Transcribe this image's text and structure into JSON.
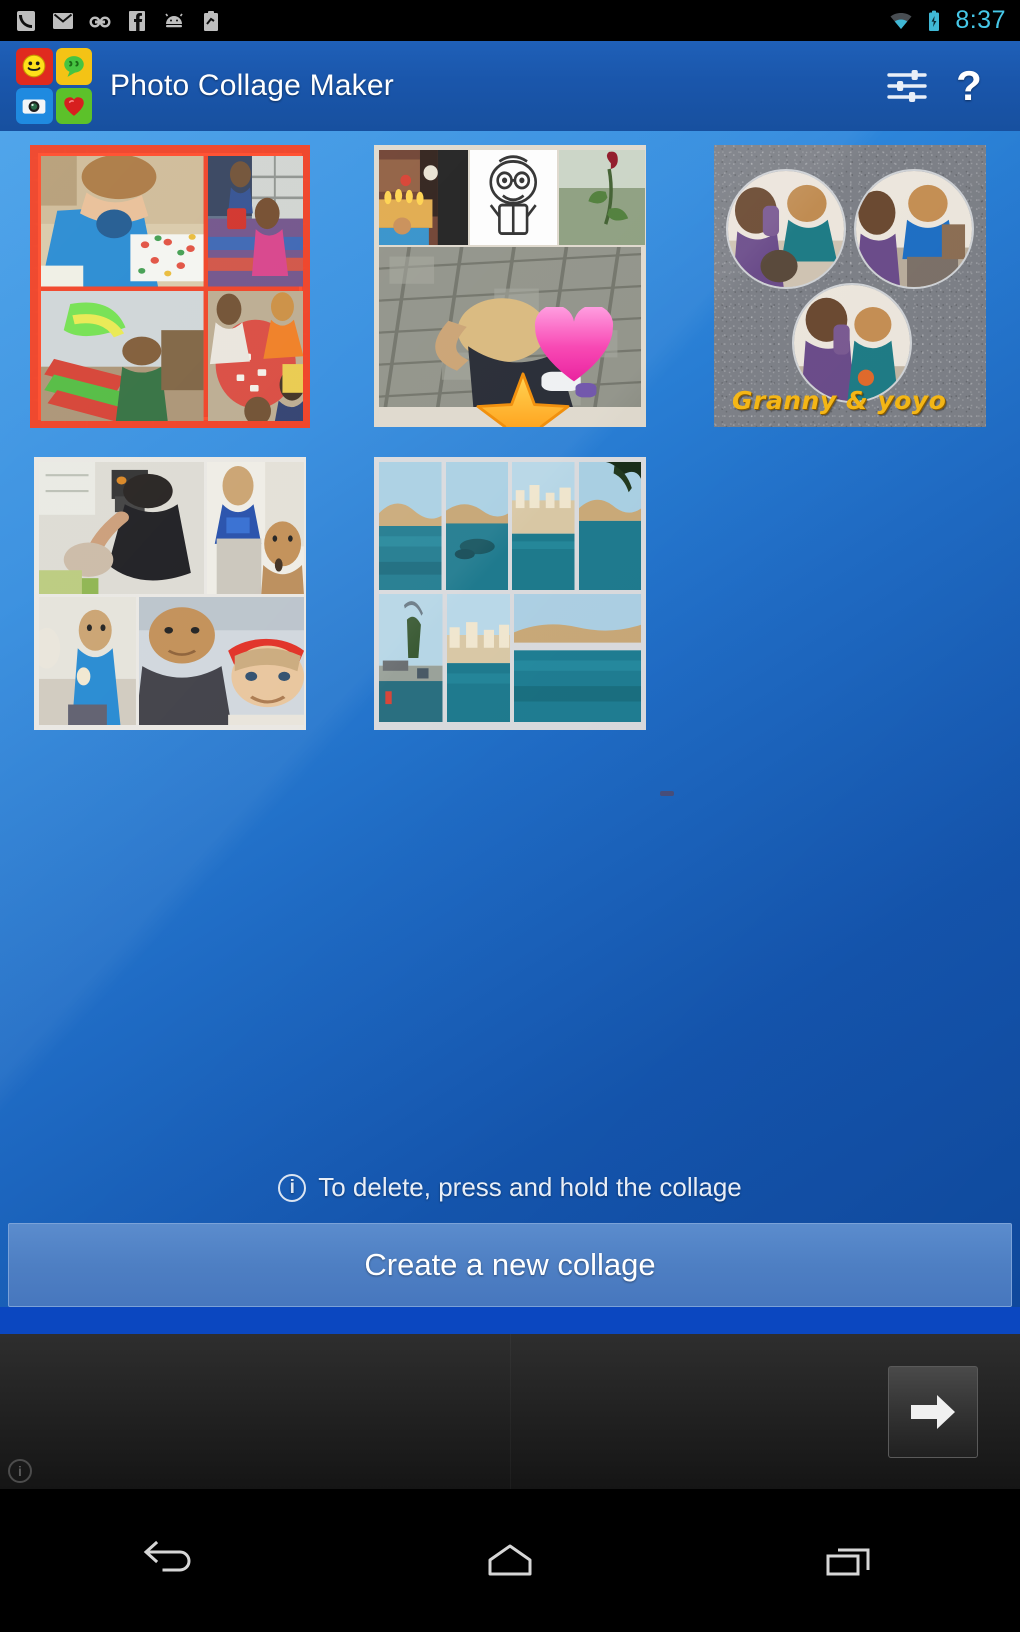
{
  "status_bar": {
    "time": "8:37",
    "time_color": "#46c8e8",
    "left_icons": [
      "phone-icon",
      "gmail-icon",
      "voicemail-icon",
      "facebook-icon",
      "android-update-icon",
      "clipboard-icon"
    ],
    "right_icons": [
      "wifi-icon",
      "battery-charging-icon"
    ]
  },
  "action_bar": {
    "app_title": "Photo Collage Maker",
    "background_color": "#1a56ab",
    "logo_tiles": [
      "smiley-red-tile",
      "speech-bubble-yellow-tile",
      "camera-blue-tile",
      "heart-green-tile"
    ],
    "settings_label": "settings",
    "help_label": "?"
  },
  "collages": [
    {
      "id": "collage-1",
      "name": "kids-craft-scalloped-frame",
      "cells": 4,
      "frame": "scalloped-red-border"
    },
    {
      "id": "collage-2",
      "name": "cobblestone-with-stickers",
      "cells": 4,
      "stickers": [
        "pink-heart",
        "orange-star"
      ]
    },
    {
      "id": "collage-3",
      "name": "granny-and-yoyo",
      "cells": 3,
      "caption": "Granny & yoyo",
      "caption_color": "#f5b716",
      "background": "gray-texture"
    },
    {
      "id": "collage-4",
      "name": "family-snapshots",
      "cells": 4,
      "frame": "white-border"
    },
    {
      "id": "collage-5",
      "name": "seascape-strips",
      "cells": 7,
      "frame": "white-border"
    }
  ],
  "hint": {
    "icon": "info-circle-icon",
    "text": "To delete, press and hold the collage"
  },
  "create_button": {
    "label": "Create a new collage"
  },
  "ad_banner": {
    "arrow_label": "next",
    "info_label": "i"
  },
  "nav_bar": {
    "buttons": [
      "back-icon",
      "home-icon",
      "recents-icon"
    ]
  }
}
